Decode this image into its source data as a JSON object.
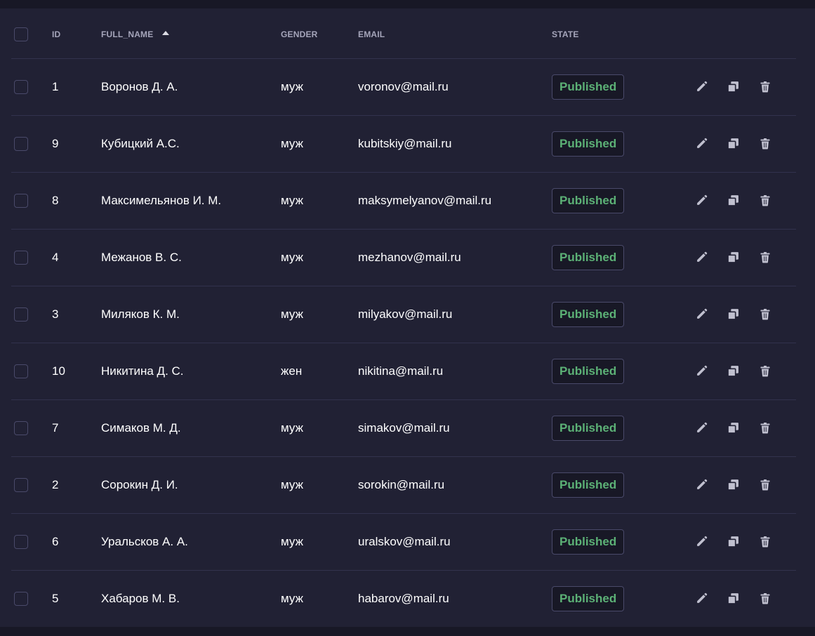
{
  "table": {
    "headers": {
      "id": "ID",
      "full_name": "FULL_NAME",
      "gender": "GENDER",
      "email": "EMAIL",
      "state": "STATE"
    },
    "sort": {
      "column": "full_name",
      "direction": "ascending",
      "icon": "caret-up-icon"
    },
    "rows": [
      {
        "id": "1",
        "full_name": "Воронов Д. А.",
        "gender": "муж",
        "email": "voronov@mail.ru",
        "state": "Published"
      },
      {
        "id": "9",
        "full_name": "Кубицкий А.С.",
        "gender": "муж",
        "email": "kubitskiy@mail.ru",
        "state": "Published"
      },
      {
        "id": "8",
        "full_name": "Максимельянов И. М.",
        "gender": "муж",
        "email": "maksymelyanov@mail.ru",
        "state": "Published"
      },
      {
        "id": "4",
        "full_name": "Межанов В. С.",
        "gender": "муж",
        "email": "mezhanov@mail.ru",
        "state": "Published"
      },
      {
        "id": "3",
        "full_name": "Миляков К. М.",
        "gender": "муж",
        "email": "milyakov@mail.ru",
        "state": "Published"
      },
      {
        "id": "10",
        "full_name": "Никитина Д. С.",
        "gender": "жен",
        "email": "nikitina@mail.ru",
        "state": "Published"
      },
      {
        "id": "7",
        "full_name": "Симаков М. Д.",
        "gender": "муж",
        "email": "simakov@mail.ru",
        "state": "Published"
      },
      {
        "id": "2",
        "full_name": "Сорокин Д. И.",
        "gender": "муж",
        "email": "sorokin@mail.ru",
        "state": "Published"
      },
      {
        "id": "6",
        "full_name": "Уральсков А. А.",
        "gender": "муж",
        "email": "uralskov@mail.ru",
        "state": "Published"
      },
      {
        "id": "5",
        "full_name": "Хабаров М. В.",
        "gender": "муж",
        "email": "habarov@mail.ru",
        "state": "Published"
      }
    ],
    "row_actions": [
      "edit-icon",
      "duplicate-icon",
      "trash-icon"
    ]
  },
  "colors": {
    "background": "#181826",
    "panel": "#212134",
    "divider": "#32324d",
    "header_text": "#a5a5ba",
    "text": "#ffffff",
    "published_text": "#5cb176",
    "badge_bg": "#181826",
    "icon": "#c0c0cf"
  }
}
